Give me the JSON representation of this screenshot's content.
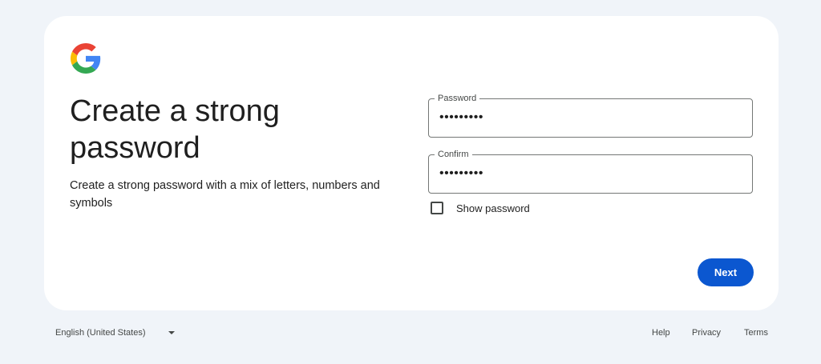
{
  "card": {
    "title": "Create a strong password",
    "subtitle": "Create a strong password with a mix of letters, numbers and symbols"
  },
  "form": {
    "password": {
      "label": "Password",
      "value": "•••••••••"
    },
    "confirm": {
      "label": "Confirm",
      "value": "•••••••••"
    },
    "show_password": {
      "label": "Show password",
      "checked": false
    },
    "next_label": "Next"
  },
  "footer": {
    "language": "English (United States)",
    "links": {
      "help": "Help",
      "privacy": "Privacy",
      "terms": "Terms"
    }
  },
  "colors": {
    "background": "#f0f4f9",
    "card": "#ffffff",
    "primary_button": "#0b57d0",
    "logo_blue": "#4285F4",
    "logo_red": "#EA4335",
    "logo_yellow": "#FBBC05",
    "logo_green": "#34A853"
  },
  "icons": {
    "logo": "google-g-logo",
    "language_dropdown": "caret-down-icon",
    "checkbox": "checkbox-unchecked"
  }
}
